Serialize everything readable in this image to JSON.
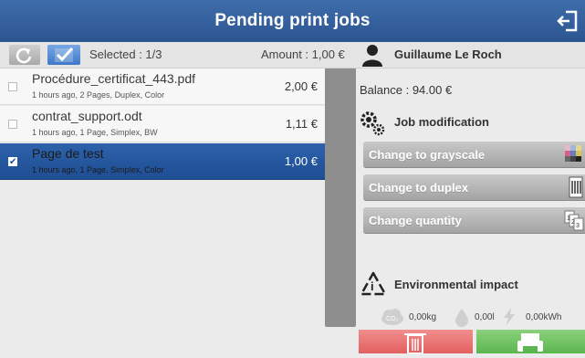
{
  "header": {
    "title": "Pending print jobs",
    "logout_icon": "logout-icon"
  },
  "toolbar": {
    "refresh_icon": "refresh-icon",
    "select_icon": "checkmark-icon",
    "selected": "Selected : 1/3",
    "amount": "Amount : 1,00 €",
    "user_icon": "user-icon",
    "user_name": "Guillaume Le Roch"
  },
  "jobs": [
    {
      "name": "Procédure_certificat_443.pdf",
      "meta": "1 hours ago, 2 Pages, Duplex, Color",
      "price": "2,00 €",
      "checked": false
    },
    {
      "name": "contrat_support.odt",
      "meta": "1 hours ago, 1 Page, Simplex, BW",
      "price": "1,11 €",
      "checked": false
    },
    {
      "name": "Page de test",
      "meta": "1 hours ago, 1 Page, Simplex, Color",
      "price": "1,00 €",
      "checked": true
    }
  ],
  "right_panel": {
    "balance": "Balance : 94.00 €",
    "job_modification_title": "Job modification",
    "buttons": [
      {
        "label": "Change to grayscale",
        "icon": "grayscale-icon"
      },
      {
        "label": "Change to duplex",
        "icon": "duplex-icon"
      },
      {
        "label": "Change quantity",
        "icon": "quantity-icon"
      }
    ],
    "environment_title": "Environmental impact",
    "impact": {
      "co2": "0,00kg",
      "water": "0,00l",
      "energy": "0,00kWh"
    }
  },
  "footer": {
    "delete_icon": "trash-icon",
    "print_icon": "printer-icon"
  },
  "colors": {
    "header": "#2c5590",
    "selected_row": "#1e4d92",
    "delete": "#e25f5f",
    "print": "#5cb64f"
  }
}
